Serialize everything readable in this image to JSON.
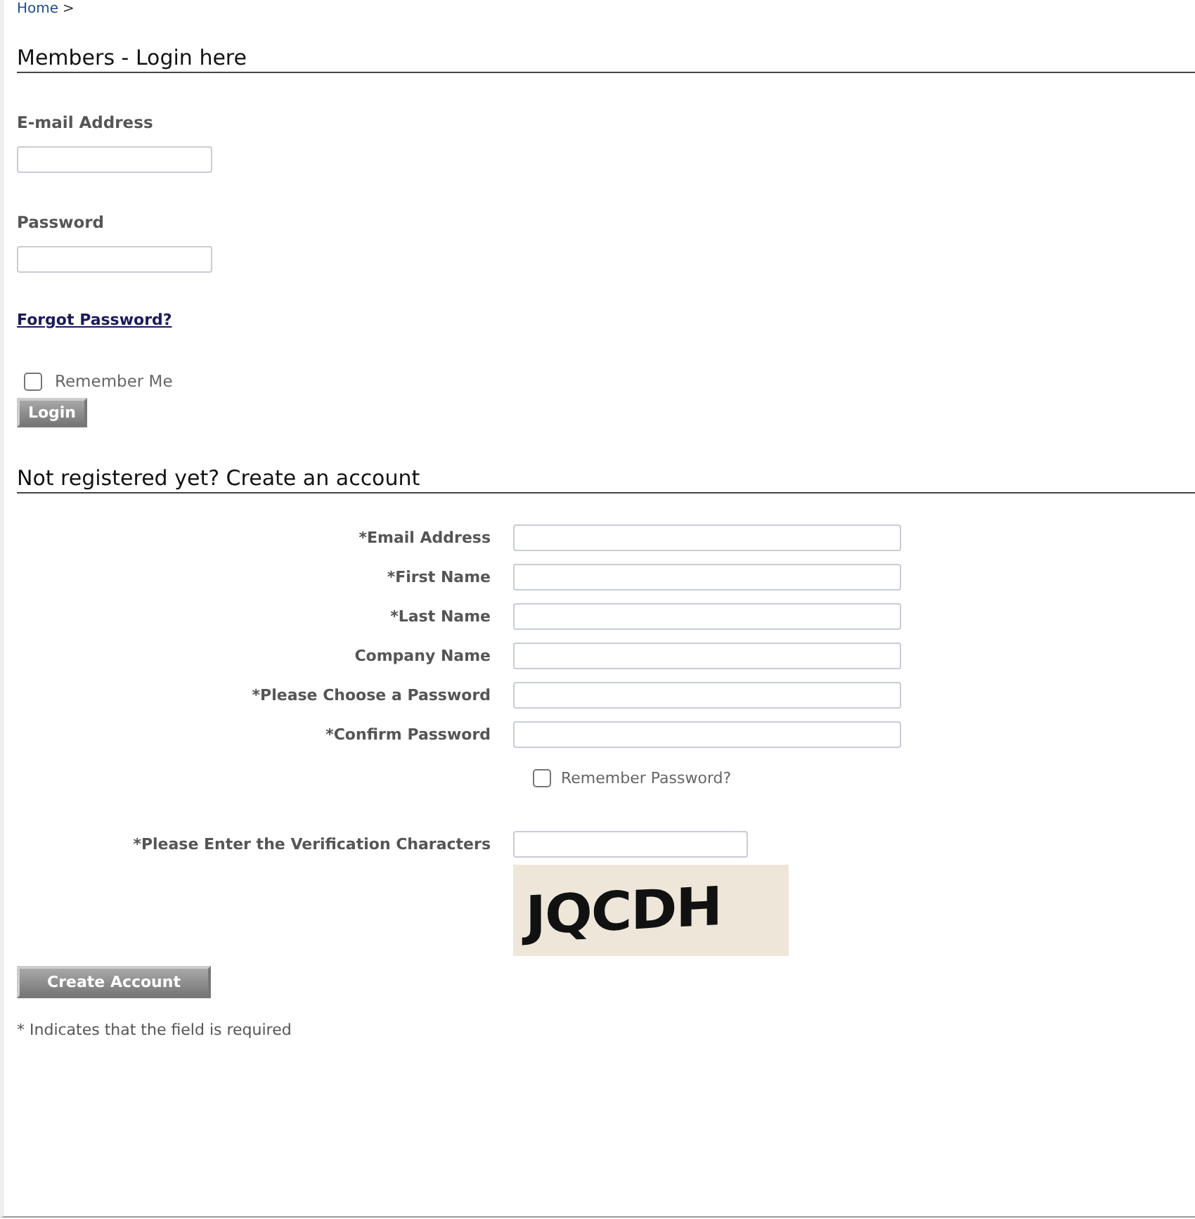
{
  "breadcrumb": {
    "link": "Home",
    "separator": ">"
  },
  "login": {
    "heading": "Members - Login here",
    "fields": [
      {
        "label": "E-mail Address"
      },
      {
        "label": "Password"
      }
    ],
    "forgot_link": "Forgot Password?",
    "remember": {
      "label": "Remember Me",
      "checked": false
    },
    "button": "Login"
  },
  "register": {
    "heading": "Not registered yet? Create an account",
    "fields": [
      {
        "label": "*Email Address"
      },
      {
        "label": "*First Name"
      },
      {
        "label": "*Last Name"
      },
      {
        "label": "Company Name"
      },
      {
        "label": "*Please Choose a Password"
      },
      {
        "label": "*Confirm Password"
      }
    ],
    "remember": {
      "label": "Remember Password?",
      "checked": false
    },
    "verification": {
      "label": "*Please Enter the Verification Characters",
      "captcha": "JQCDH"
    },
    "button": "Create Account",
    "note": "* Indicates that the field is required"
  }
}
